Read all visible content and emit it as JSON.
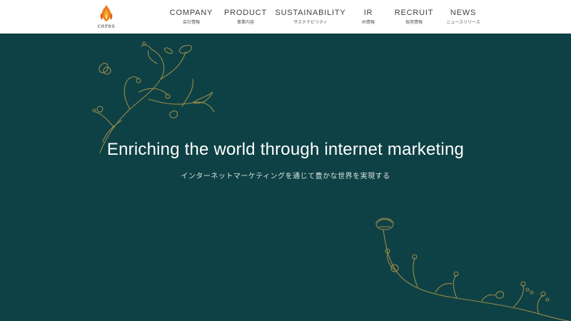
{
  "header": {
    "logo": {
      "text": "ceres",
      "icon": "flame-icon"
    },
    "nav": [
      {
        "en": "COMPANY",
        "jp": "会社情報"
      },
      {
        "en": "PRODUCT",
        "jp": "事業内容"
      },
      {
        "en": "SUSTAINABILITY",
        "jp": "サステナビリティ"
      },
      {
        "en": "IR",
        "jp": "IR情報"
      },
      {
        "en": "RECRUIT",
        "jp": "採用情報"
      },
      {
        "en": "NEWS",
        "jp": "ニュースリリース"
      }
    ]
  },
  "hero": {
    "title": "Enriching the world through internet marketing",
    "subtitle": "インターネットマーケティングを通じて豊かな世界を実現する",
    "background_color": "#0e4145",
    "ornament_color": "#9a8a4a"
  }
}
